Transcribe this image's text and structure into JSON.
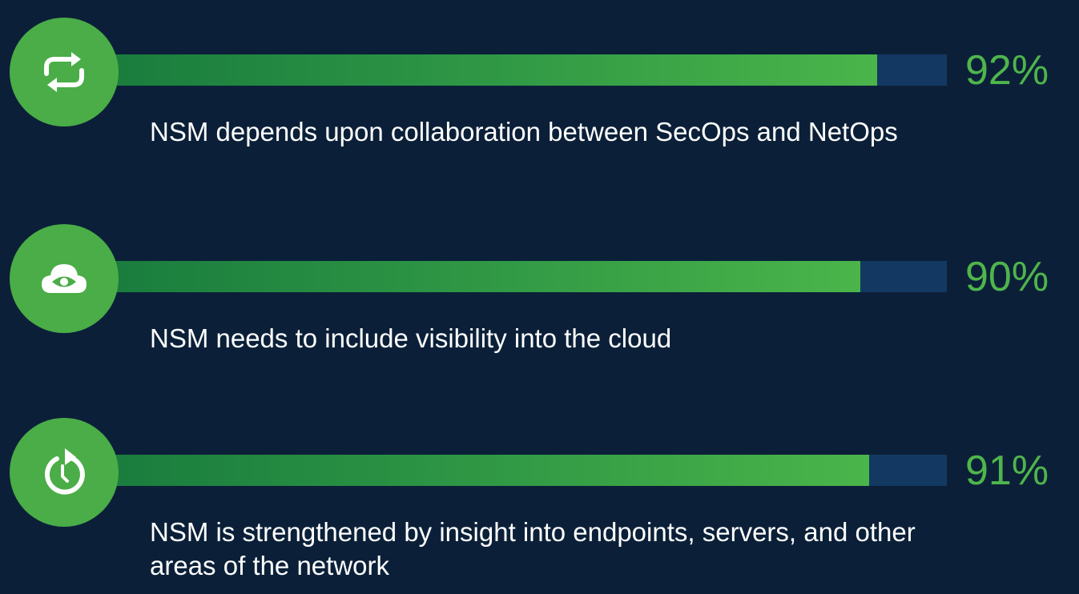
{
  "colors": {
    "background": "#0b2038",
    "accent_green": "#4aad47",
    "bar_track": "#133962",
    "value_text": "#4fb54c",
    "desc_text": "#ffffff"
  },
  "stats": [
    {
      "icon": "sync-arrows-icon",
      "value_label": "92%",
      "value": 0.92,
      "description": "NSM depends upon collaboration between SecOps and NetOps"
    },
    {
      "icon": "cloud-eye-icon",
      "value_label": "90%",
      "value": 0.9,
      "description": "NSM needs to include visibility into the cloud"
    },
    {
      "icon": "refresh-clock-icon",
      "value_label": "91%",
      "value": 0.91,
      "description": "NSM is strengthened by insight into endpoints, servers, and other areas of the network"
    }
  ],
  "chart_data": {
    "type": "bar",
    "orientation": "horizontal",
    "categories": [
      "NSM depends upon collaboration between SecOps and NetOps",
      "NSM needs to include visibility into the cloud",
      "NSM is strengthened by insight into endpoints, servers, and other areas of the network"
    ],
    "values": [
      92,
      90,
      91
    ],
    "value_labels": [
      "92%",
      "90%",
      "91%"
    ],
    "ylim": [
      0,
      100
    ],
    "grid": false,
    "legend": "none"
  }
}
